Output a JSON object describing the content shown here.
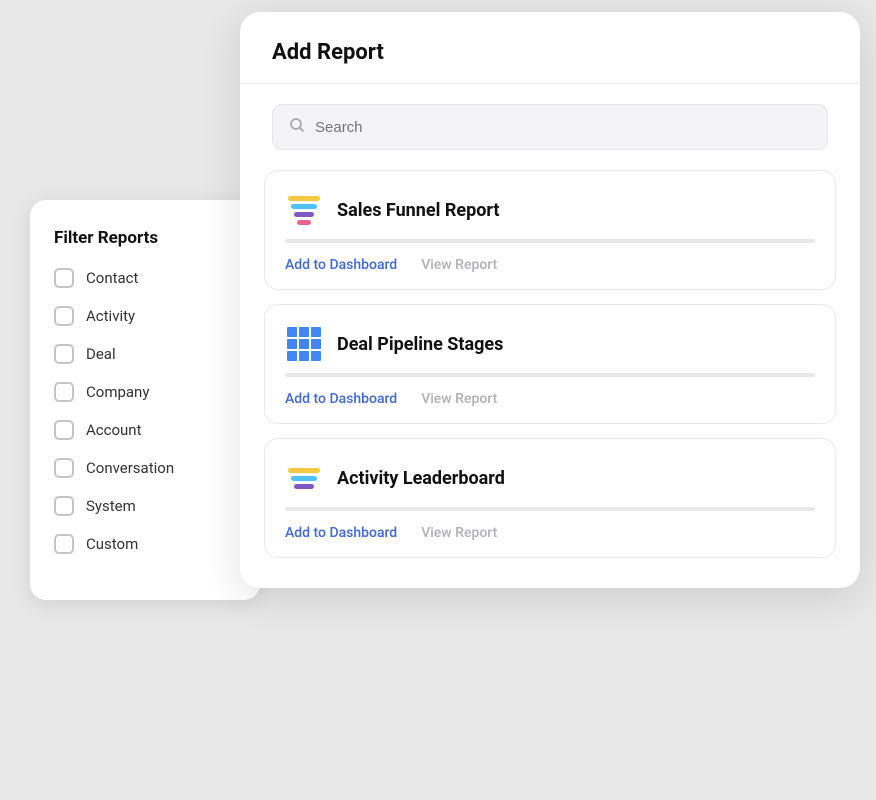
{
  "filterPanel": {
    "title": "Filter Reports",
    "items": [
      {
        "label": "Contact"
      },
      {
        "label": "Activity"
      },
      {
        "label": "Deal"
      },
      {
        "label": "Company"
      },
      {
        "label": "Account"
      },
      {
        "label": "Conversation"
      },
      {
        "label": "System"
      },
      {
        "label": "Custom"
      }
    ]
  },
  "mainPanel": {
    "title": "Add Report",
    "search": {
      "placeholder": "Search"
    },
    "reports": [
      {
        "name": "Sales Funnel Report",
        "iconType": "funnel",
        "addLabel": "Add to Dashboard",
        "viewLabel": "View Report"
      },
      {
        "name": "Deal Pipeline Stages",
        "iconType": "grid",
        "addLabel": "Add to Dashboard",
        "viewLabel": "View Report"
      },
      {
        "name": "Activity Leaderboard",
        "iconType": "funnel2",
        "addLabel": "Add to Dashboard",
        "viewLabel": "View Report"
      }
    ]
  }
}
